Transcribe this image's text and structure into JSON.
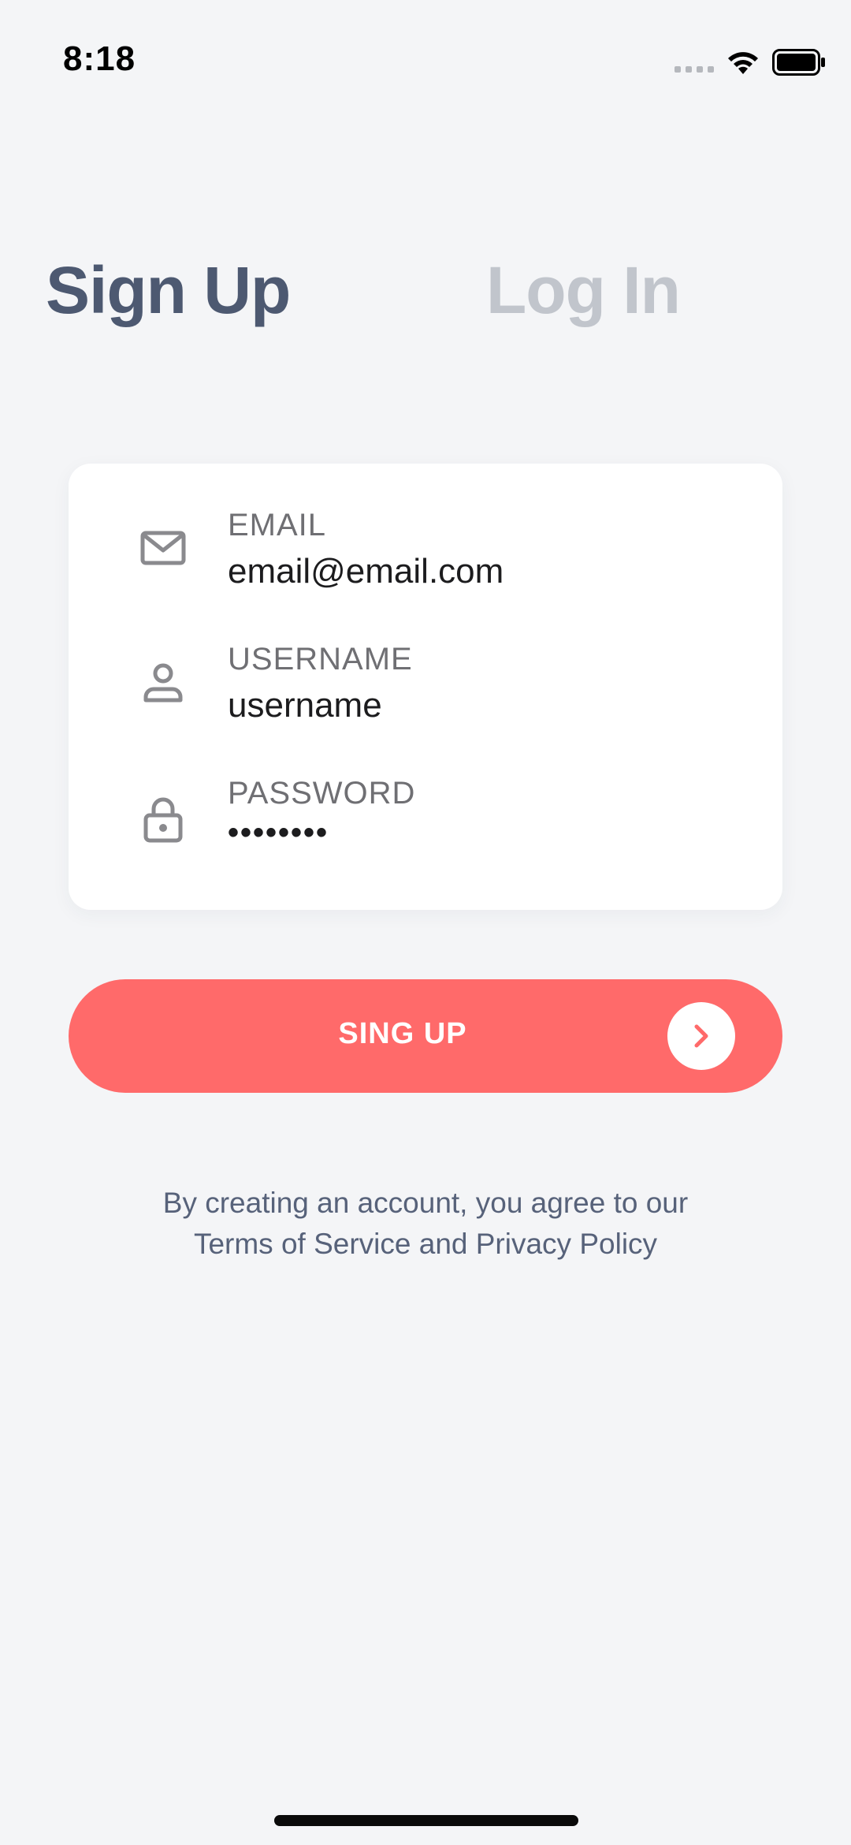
{
  "status_bar": {
    "time": "8:18"
  },
  "tabs": {
    "signup": "Sign Up",
    "login": "Log In",
    "active": "signup"
  },
  "form": {
    "email": {
      "label": "EMAIL",
      "value": "email@email.com",
      "icon": "mail-icon"
    },
    "username": {
      "label": "USERNAME",
      "value": "username",
      "icon": "user-icon"
    },
    "password": {
      "label": "PASSWORD",
      "value": "••••••••",
      "icon": "lock-icon"
    }
  },
  "submit": {
    "label": "SING UP",
    "icon": "chevron-right-icon"
  },
  "legal": {
    "line1": "By creating an account, you agree to our",
    "line2": "Terms of Service and Privacy Policy"
  },
  "colors": {
    "accent": "#ff6a6a",
    "heading": "#4d5971",
    "inactive_tab": "#c1c5cc",
    "background": "#f4f5f7"
  }
}
